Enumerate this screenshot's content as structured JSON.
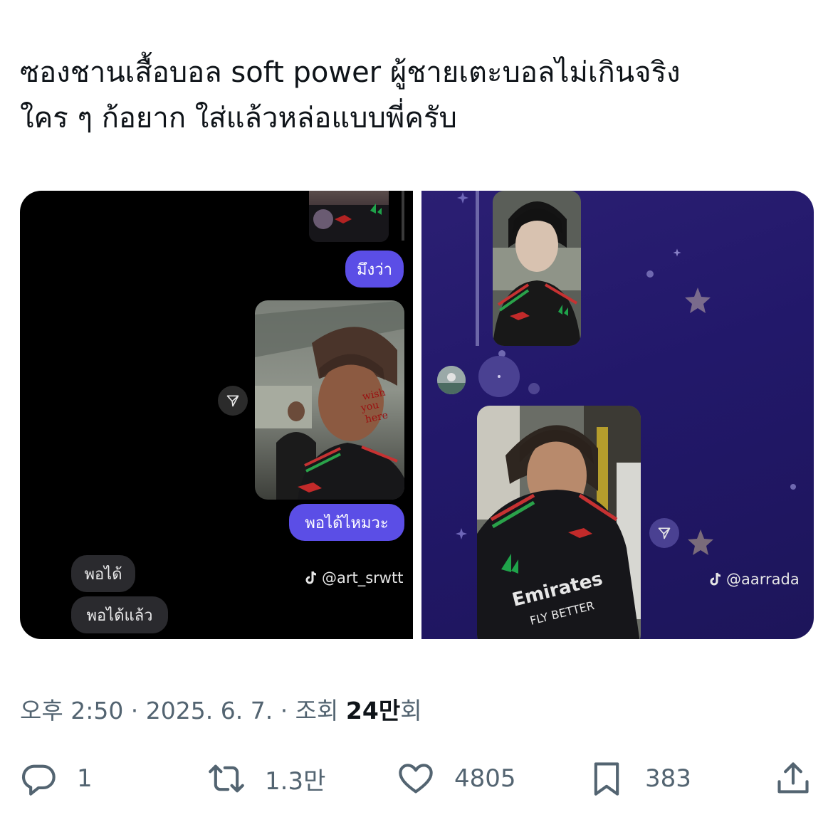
{
  "tweet": {
    "text_line1": "ซองชานเสื้อบอล soft power ผู้ชายเตะบอลไม่เกินจริง",
    "text_line2": "ใคร ๆ ก้อยาก ใส่แล้วหล่อแบบพี่ครับ"
  },
  "media": {
    "left": {
      "bubble_1": "มึงว่า",
      "bubble_2": "พอได้ไหมวะ",
      "reply_1": "พอได้",
      "reply_2": "พอได้แล้ว",
      "watermark": "@art_srwtt",
      "sticker": "wish you here"
    },
    "right": {
      "watermark": "@aarrada",
      "jersey_text": "Emirates FLY BETTER"
    }
  },
  "meta": {
    "time": "오후 2:50 · 2025. 6. 7. · 조회 ",
    "views": "24만",
    "views_suffix": "회"
  },
  "actions": {
    "reply_count": "1",
    "retweet_count": "1.3만",
    "like_count": "4805",
    "bookmark_count": "383"
  },
  "colors": {
    "text": "#0f1419",
    "secondary": "#536471",
    "bubble_me": "#5b4ee6",
    "right_bg": "#22186a"
  },
  "icons": [
    "reply-icon",
    "retweet-icon",
    "like-icon",
    "bookmark-icon",
    "share-icon",
    "send-icon",
    "tiktok-icon",
    "star-icon"
  ]
}
